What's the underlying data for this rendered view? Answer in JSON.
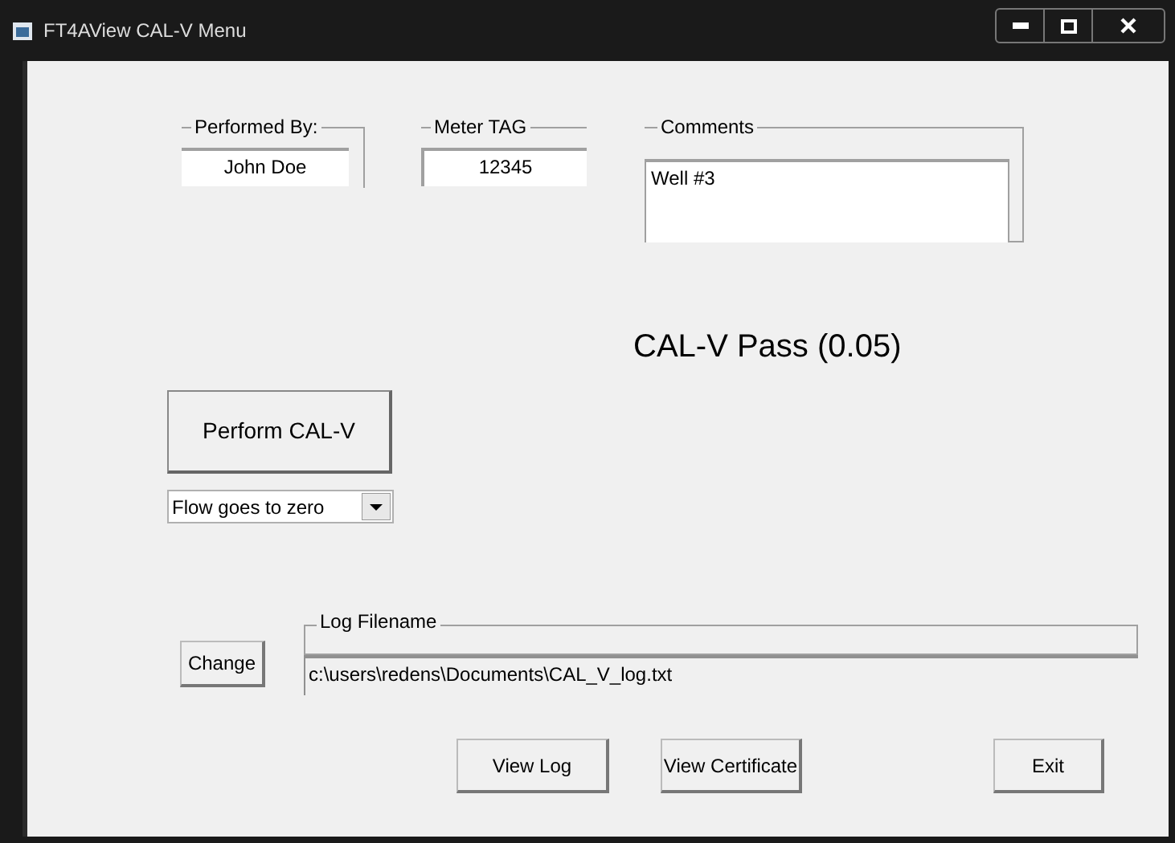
{
  "window": {
    "title": "FT4AView CAL-V Menu"
  },
  "performed_by": {
    "label": "Performed By:",
    "value": "John Doe"
  },
  "meter_tag": {
    "label": "Meter TAG",
    "value": "12345"
  },
  "comments": {
    "label": "Comments",
    "value": "Well #3"
  },
  "result": "CAL-V Pass (0.05)",
  "perform_button": "Perform CAL-V",
  "mode_dropdown": {
    "value": "Flow goes to zero"
  },
  "change_button": "Change",
  "log_filename": {
    "label": "Log Filename",
    "value": "c:\\users\\redens\\Documents\\CAL_V_log.txt"
  },
  "buttons": [
    "View Log",
    "View Certificate",
    "Exit"
  ]
}
